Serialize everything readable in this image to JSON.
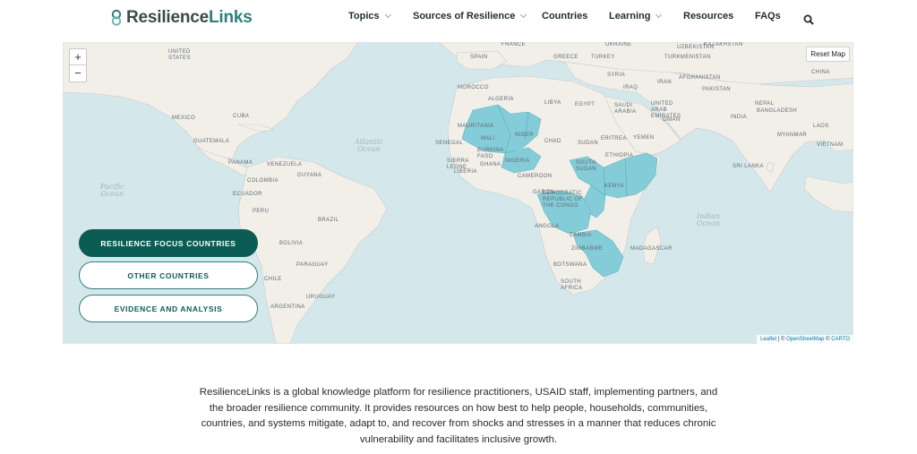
{
  "brand": {
    "name_part1": "Resilience",
    "name_part2": "Links",
    "accent": "#2e7f7c"
  },
  "nav": {
    "items": [
      {
        "label": "Topics",
        "dropdown": true
      },
      {
        "label": "Sources of Resilience",
        "dropdown": true
      },
      {
        "label": "Countries",
        "dropdown": false
      },
      {
        "label": "Learning",
        "dropdown": true
      },
      {
        "label": "Resources",
        "dropdown": false
      },
      {
        "label": "FAQs",
        "dropdown": false
      }
    ],
    "search_icon": "search-icon"
  },
  "map": {
    "zoom_in": "+",
    "zoom_out": "−",
    "reset_label": "Reset Map",
    "attribution": {
      "leaflet": "Leaflet",
      "sep1": " | © ",
      "osm": "OpenStreetMap",
      "sep2": " © ",
      "carto": "CARTO"
    },
    "highlight_color": "#7fcbd8",
    "oceans": {
      "atlantic": "Atlantic\nOcean",
      "pacific": "Pacific\nOcean",
      "indian": "Indian\nOcean"
    },
    "labels": [
      "UNITED STATES",
      "MEXICO",
      "CUBA",
      "GUATEMALA",
      "PANAMA",
      "VENEZUELA",
      "GUYANA",
      "COLOMBIA",
      "ECUADOR",
      "PERU",
      "BRAZIL",
      "BOLIVIA",
      "PARAGUAY",
      "URUGUAY",
      "CHILE",
      "ARGENTINA",
      "SPAIN",
      "FRANCE",
      "GREECE",
      "TURKEY",
      "UKRAINE",
      "KAZAKHSTAN",
      "UZBEKISTAN",
      "TURKMENISTAN",
      "MOROCCO",
      "ALGERIA",
      "LIBYA",
      "EGYPT",
      "SYRIA",
      "IRAQ",
      "IRAN",
      "AFGHANISTAN",
      "PAKISTAN",
      "INDIA",
      "CHINA",
      "NEPAL",
      "BANGLADESH",
      "MYANMAR",
      "LAOS",
      "VIETNAM",
      "SRI LANKA",
      "SAUDI ARABIA",
      "UNITED ARAB EMIRATES",
      "OMAN",
      "YEMEN",
      "ERITREA",
      "MAURITANIA",
      "MALI",
      "NIGER",
      "CHAD",
      "SUDAN",
      "SENEGAL",
      "BURKINA FASO",
      "SIERRA LEONE",
      "LIBERIA",
      "GHANA",
      "NIGERIA",
      "CAMEROON",
      "GABON",
      "ETHIOPIA",
      "SOUTH SUDAN",
      "KENYA",
      "DEMOCRATIC REPUBLIC OF THE CONGO",
      "ANGOLA",
      "ZAMBIA",
      "ZIMBABWE",
      "MADAGASCAR",
      "BOTSWANA",
      "SOUTH AFRICA"
    ],
    "focus_buttons": [
      {
        "label": "RESILIENCE FOCUS COUNTRIES",
        "active": true
      },
      {
        "label": "OTHER COUNTRIES",
        "active": false
      },
      {
        "label": "EVIDENCE AND ANALYSIS",
        "active": false
      }
    ]
  },
  "intro_text": "ResilienceLinks is a global knowledge platform for resilience practitioners, USAID staff, implementing partners, and the broader resilience community. It provides resources on how best to help people, households, communities, countries, and systems mitigate, adapt to, and recover from shocks and stresses in a manner that reduces chronic vulnerability and facilitates inclusive growth."
}
